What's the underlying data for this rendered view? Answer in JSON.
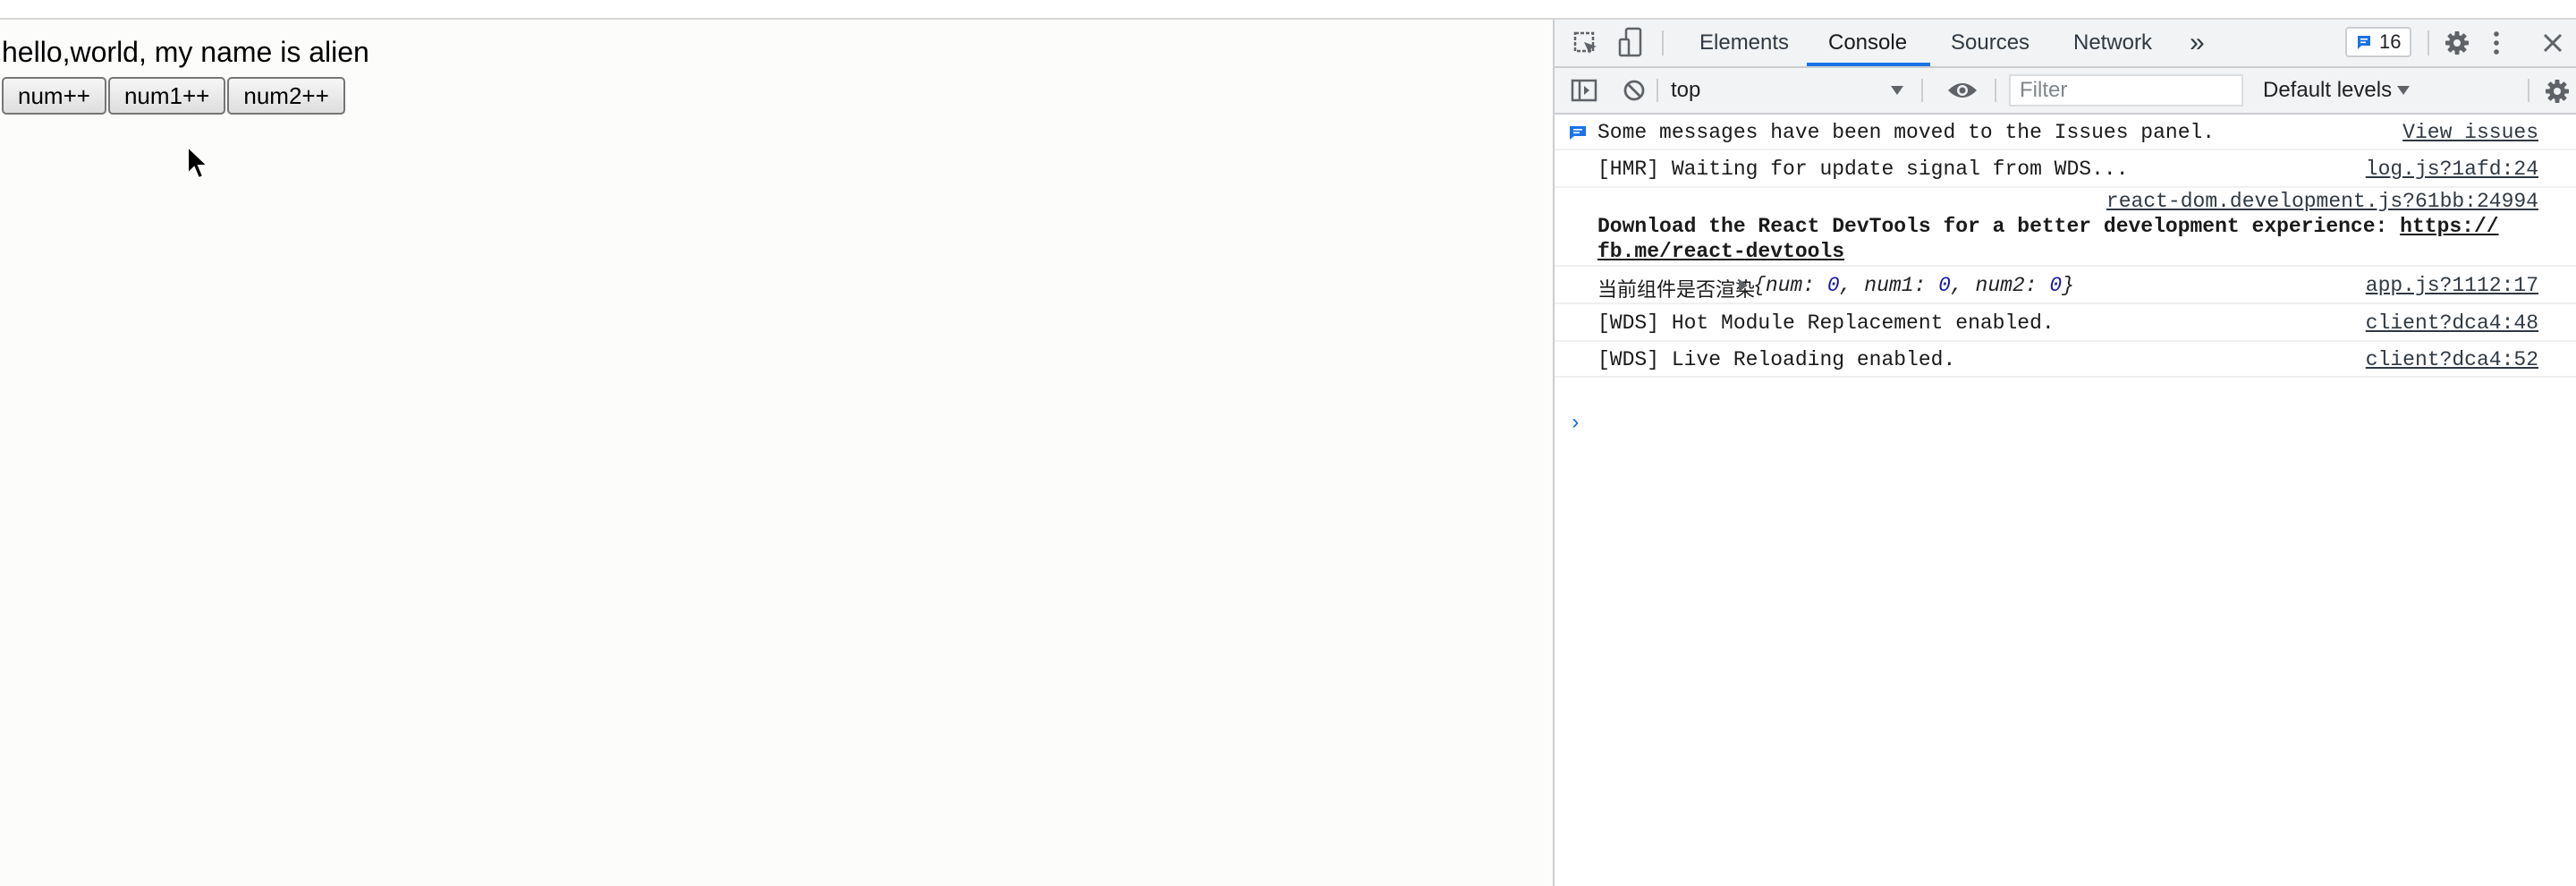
{
  "page": {
    "greeting": "hello,world, my name is alien",
    "buttons": [
      "num++",
      "num1++",
      "num2++"
    ]
  },
  "devtools": {
    "tabs": [
      "Elements",
      "Console",
      "Sources",
      "Network"
    ],
    "active_tab": "Console",
    "more_tabs_glyph": "»",
    "issues_count": "16",
    "toolbar": {
      "context": "top",
      "filter_placeholder": "Filter",
      "levels": "Default levels"
    },
    "messages": [
      {
        "text": "Some messages have been moved to the Issues panel.",
        "source": "View issues"
      },
      {
        "text": "[HMR] Waiting for update signal from WDS...",
        "source": "log.js?1afd:24"
      },
      {
        "source": "react-dom.development.js?61bb:24994",
        "text_bold": "Download the React DevTools for a better development experience: ",
        "link_part1": "https://",
        "link_part2": "fb.me/react-devtools"
      },
      {
        "label": "当前组件是否渲染",
        "object": {
          "open": "{",
          "k1": "num",
          "v1": "0",
          "k2": "num1",
          "v2": "0",
          "k3": "num2",
          "v3": "0",
          "close": "}"
        },
        "source": "app.js?1112:17"
      },
      {
        "text": "[WDS] Hot Module Replacement enabled.",
        "source": "client?dca4:48"
      },
      {
        "text": "[WDS] Live Reloading enabled.",
        "source": "client?dca4:52"
      }
    ],
    "prompt_glyph": "›"
  },
  "colors": {
    "accent": "#1a73e8",
    "issues_icon": "#1a73e8",
    "number_value": "#1a1aa6"
  },
  "icons": [
    "inspect-element-icon",
    "device-toolbar-icon",
    "settings-gear-icon",
    "kebab-menu-icon",
    "close-icon",
    "sidebar-toggle-icon",
    "clear-console-icon",
    "eye-icon",
    "console-settings-gear-icon",
    "issues-message-icon",
    "mouse-cursor-icon"
  ]
}
